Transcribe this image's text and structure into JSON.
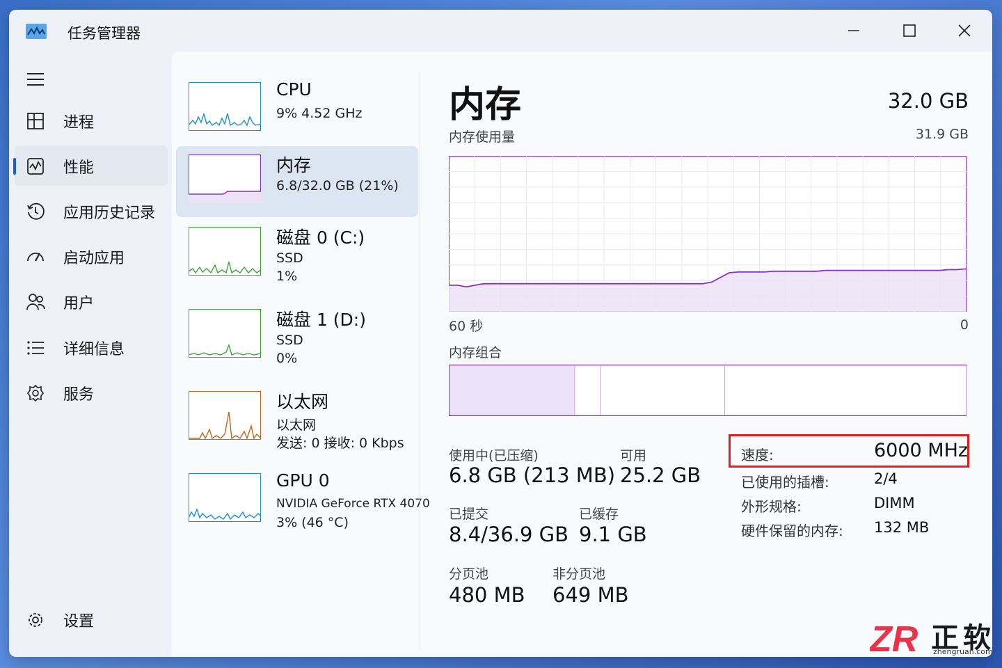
{
  "window": {
    "title": "任务管理器",
    "controls": [
      "minimize",
      "maximize",
      "close"
    ]
  },
  "sidebar": {
    "items": [
      {
        "label": "进程",
        "icon": "processes-icon"
      },
      {
        "label": "性能",
        "icon": "performance-icon",
        "active": true
      },
      {
        "label": "应用历史记录",
        "icon": "history-icon"
      },
      {
        "label": "启动应用",
        "icon": "startup-icon"
      },
      {
        "label": "用户",
        "icon": "users-icon"
      },
      {
        "label": "详细信息",
        "icon": "details-icon"
      },
      {
        "label": "服务",
        "icon": "services-icon"
      }
    ],
    "settings_label": "设置"
  },
  "perf_list": [
    {
      "name": "CPU",
      "line1": "9%  4.52 GHz",
      "line2": "",
      "color": "#1c8fd1"
    },
    {
      "name": "内存",
      "line1": "6.8/32.0 GB (21%)",
      "line2": "",
      "color": "#8b2fc9",
      "active": true
    },
    {
      "name": "磁盘 0 (C:)",
      "line1": "SSD",
      "line2": "1%",
      "color": "#3aa63a"
    },
    {
      "name": "磁盘 1 (D:)",
      "line1": "SSD",
      "line2": "0%",
      "color": "#3aa63a"
    },
    {
      "name": "以太网",
      "line1": "以太网",
      "line2": "发送: 0 接收: 0 Kbps",
      "color": "#c5661a"
    },
    {
      "name": "GPU 0",
      "line1": "NVIDIA GeForce RTX 4070",
      "line2": "3%  (46 °C)",
      "color": "#1c8fd1"
    }
  ],
  "memory": {
    "title": "内存",
    "total": "32.0 GB",
    "usage_label": "内存使用量",
    "usage_max": "31.9 GB",
    "axis_left": "60 秒",
    "axis_right": "0",
    "composition_label": "内存组合",
    "usage_history_fraction": [
      0.17,
      0.17,
      0.16,
      0.17,
      0.18,
      0.18,
      0.18,
      0.18,
      0.18,
      0.18,
      0.18,
      0.18,
      0.18,
      0.18,
      0.18,
      0.18,
      0.18,
      0.18,
      0.18,
      0.18,
      0.18,
      0.18,
      0.18,
      0.18,
      0.18,
      0.18,
      0.18,
      0.18,
      0.18,
      0.18,
      0.19,
      0.22,
      0.25,
      0.255,
      0.255,
      0.255,
      0.255,
      0.26,
      0.26,
      0.26,
      0.26,
      0.26,
      0.26,
      0.265,
      0.265,
      0.265,
      0.265,
      0.265,
      0.265,
      0.265,
      0.265,
      0.265,
      0.265,
      0.265,
      0.265,
      0.265,
      0.265,
      0.27,
      0.27,
      0.275
    ],
    "composition_fractions": {
      "in_use": 0.243,
      "modified": 0.05,
      "standby": 0.24,
      "free": 0.467
    },
    "stats": {
      "in_use_label": "使用中(已压缩)",
      "in_use_value": "6.8 GB (213 MB)",
      "available_label": "可用",
      "available_value": "25.2 GB",
      "committed_label": "已提交",
      "committed_value": "8.4/36.9 GB",
      "cached_label": "已缓存",
      "cached_value": "9.1 GB",
      "paged_label": "分页池",
      "paged_value": "480 MB",
      "nonpaged_label": "非分页池",
      "nonpaged_value": "649 MB"
    },
    "specs": {
      "speed_label": "速度:",
      "speed_value": "6000 MHz",
      "slots_label": "已使用的插槽:",
      "slots_value": "2/4",
      "form_label": "外形规格:",
      "form_value": "DIMM",
      "reserved_label": "硬件保留的内存:",
      "reserved_value": "132 MB"
    },
    "accent_color": "#8b2fc9",
    "fill_color": "#ece2f7",
    "highlight_color": "#e02020"
  },
  "watermark": {
    "logo": "ZR",
    "brand": "正软",
    "url": "zhengruan.com"
  }
}
